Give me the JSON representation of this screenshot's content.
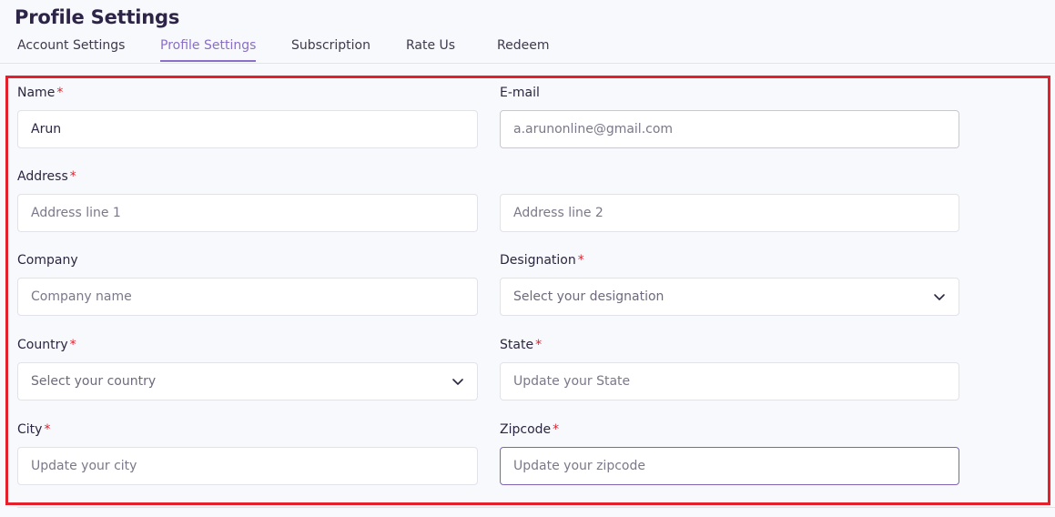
{
  "page_title": "Profile Settings",
  "tabs": [
    {
      "label": "Account Settings",
      "active": false
    },
    {
      "label": "Profile Settings",
      "active": true
    },
    {
      "label": "Subscription",
      "active": false
    },
    {
      "label": "Rate Us",
      "active": false
    },
    {
      "label": "Redeem",
      "active": false
    }
  ],
  "form": {
    "name": {
      "label": "Name",
      "required": "*",
      "value": "Arun"
    },
    "email": {
      "label": "E-mail",
      "placeholder": "a.arunonline@gmail.com"
    },
    "address": {
      "label": "Address",
      "required": "*",
      "line1_placeholder": "Address line 1",
      "line2_placeholder": "Address line 2"
    },
    "company": {
      "label": "Company",
      "placeholder": "Company name"
    },
    "designation": {
      "label": "Designation",
      "required": "*",
      "selected": "Select your designation"
    },
    "country": {
      "label": "Country",
      "required": "*",
      "selected": "Select your country"
    },
    "state": {
      "label": "State",
      "required": "*",
      "placeholder": "Update your State"
    },
    "city": {
      "label": "City",
      "required": "*",
      "placeholder": "Update your city"
    },
    "zipcode": {
      "label": "Zipcode",
      "required": "*",
      "placeholder": "Update your zipcode"
    }
  },
  "colors": {
    "accent": "#8a6fc7",
    "required": "#e5202d",
    "highlight": "#e5202d"
  }
}
